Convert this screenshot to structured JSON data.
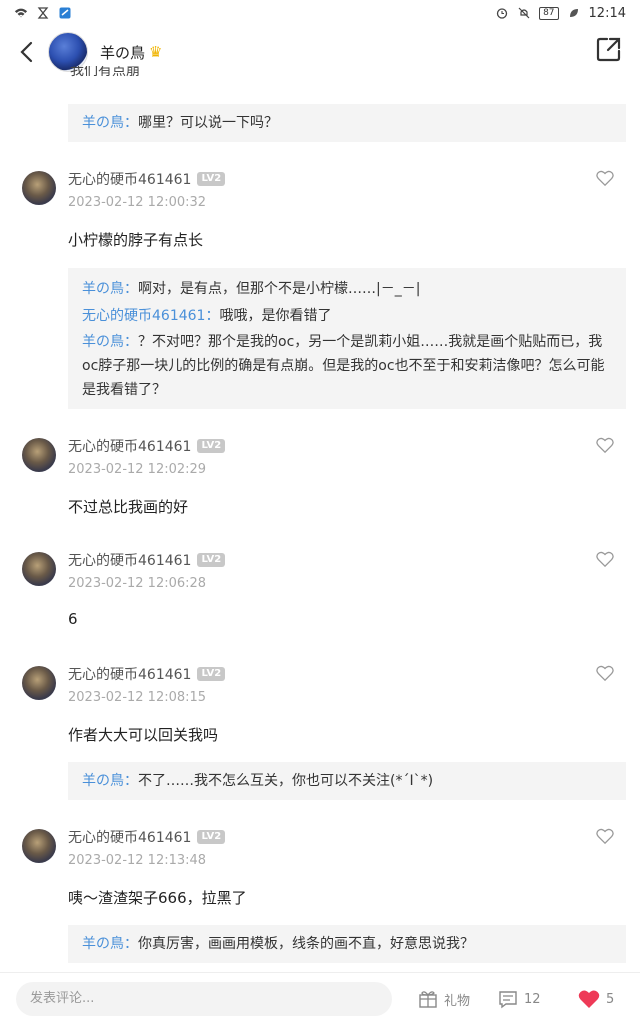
{
  "status": {
    "time": "12:14",
    "battery": "87"
  },
  "header": {
    "title": "羊の鳥",
    "crown": "♛"
  },
  "top_clipped": "我们有点崩",
  "replies_top": {
    "author": "羊の鳥：",
    "text": "哪里？可以说一下吗？"
  },
  "comments": [
    {
      "name": "无心的硬币461461",
      "level": "LV2",
      "time": "2023-02-12 12:00:32",
      "text": "小柠檬的脖子有点长",
      "replies": [
        {
          "author": "羊の鳥：",
          "text": "啊对，是有点，但那个不是小柠檬……|－_－|"
        },
        {
          "author": "无心的硬币461461：",
          "text": "哦哦，是你看错了"
        },
        {
          "author": "羊の鳥：",
          "text": "？不对吧？那个是我的oc，另一个是凯莉小姐……我就是画个贴贴而已，我oc脖子那一块儿的比例的确是有点崩。但是我的oc也不至于和安莉洁像吧？怎么可能是我看错了？"
        }
      ]
    },
    {
      "name": "无心的硬币461461",
      "level": "LV2",
      "time": "2023-02-12 12:02:29",
      "text": "不过总比我画的好"
    },
    {
      "name": "无心的硬币461461",
      "level": "LV2",
      "time": "2023-02-12 12:06:28",
      "text": "6"
    },
    {
      "name": "无心的硬币461461",
      "level": "LV2",
      "time": "2023-02-12 12:08:15",
      "text": "作者大大可以回关我吗",
      "replies": [
        {
          "author": "羊の鳥：",
          "text": "不了……我不怎么互关，你也可以不关注(*´I`*)"
        }
      ]
    },
    {
      "name": "无心的硬币461461",
      "level": "LV2",
      "time": "2023-02-12 12:13:48",
      "text": "咦～渣渣架子666，拉黑了",
      "replies": [
        {
          "author": "羊の鳥：",
          "text": "你真厉害，画画用模板，线条的画不直，好意思说我？"
        }
      ]
    }
  ],
  "bottom": {
    "input_placeholder": "发表评论...",
    "gift_label": "礼物",
    "comment_count": "12",
    "like_count": "5"
  }
}
